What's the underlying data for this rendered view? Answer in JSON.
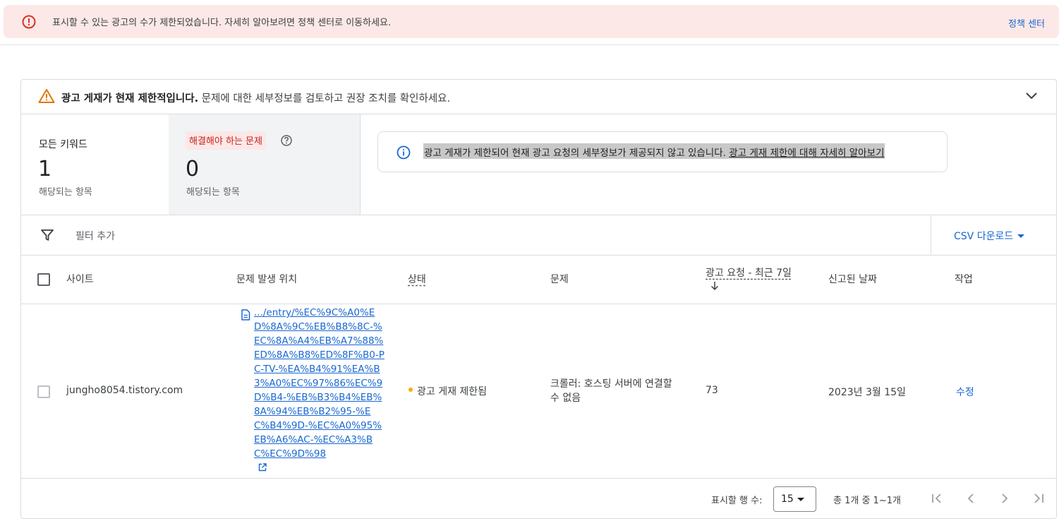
{
  "banner": {
    "message": "표시할 수 있는 광고의 수가 제한되었습니다. 자세히 알아보려면 정책 센터로 이동하세요.",
    "link_label": "정책 센터"
  },
  "alert": {
    "title": "광고 게재가 현재 제한적입니다.",
    "text": " 문제에 대한 세부정보를 검토하고 권장 조치를 확인하세요."
  },
  "summary": {
    "all_label": "모든 키워드",
    "all_count": "1",
    "all_sub": "해당되는 항목",
    "issue_label": "해결해야 하는 문제",
    "issue_count": "0",
    "issue_sub": "해당되는 항목"
  },
  "info": {
    "text": "광고 게재가 제한되어 현재 광고 요청의 세부정보가 제공되지 않고 있습니다. ",
    "link1": "광고 게재 제한",
    "link_mid": "에 대해 ",
    "link2": "자세히 알아보기"
  },
  "filter": {
    "add_label": "필터 추가",
    "csv_label": "CSV 다운로드"
  },
  "table": {
    "headers": {
      "site": "사이트",
      "location": "문제 발생 위치",
      "status": "상태",
      "problem": "문제",
      "requests": "광고 요청 - 최근 7일",
      "reported": "신고된 날짜",
      "action": "작업"
    },
    "rows": [
      {
        "site": "jungho8054.tistory.com",
        "url": ".../entry/%EC%9C%A0%ED%8A%9C%EB%B8%8C-%EC%8A%A4%EB%A7%88%ED%8A%B8%ED%8F%B0-PC-TV-%EA%B4%91%EA%B3%A0%EC%97%86%EC%9D%B4-%EB%B3%B4%EB%8A%94%EB%B2%95-%EC%B4%9D-%EC%A0%95%EB%A6%AC-%EC%A3%BC%EC%9D%98",
        "status": "광고 게재 제한됨",
        "problem": "크롤러: 호스팅 서버에 연결할 수 없음",
        "requests": "73",
        "reported": "2023년 3월 15일",
        "action": "수정"
      }
    ]
  },
  "pagination": {
    "rows_label": "표시할 행 수:",
    "rows_value": "15",
    "range": "총 1개 중 1~1개"
  },
  "colors": {
    "error": "#d93025",
    "warning": "#e37400",
    "link": "#1967d2",
    "status_dot": "#f9ab00"
  },
  "icons": [
    "error-icon",
    "warning-icon",
    "chevron-down-icon",
    "help-icon",
    "info-icon",
    "filter-icon",
    "doc-icon",
    "external-link-icon",
    "arrow-down-icon",
    "first-page-icon",
    "prev-page-icon",
    "next-page-icon",
    "last-page-icon"
  ]
}
